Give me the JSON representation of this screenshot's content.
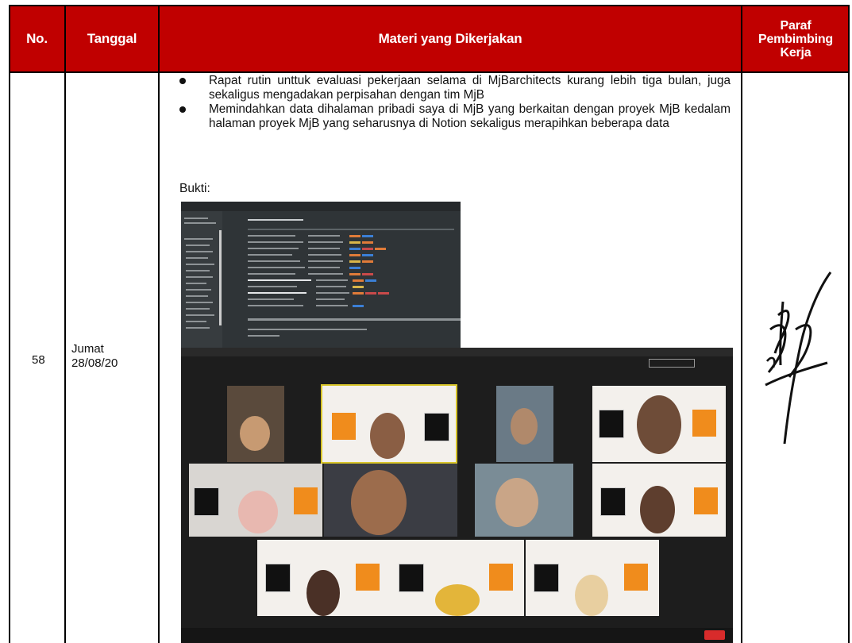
{
  "table": {
    "headers": {
      "no": "No.",
      "date": "Tanggal",
      "material": "Materi yang Dikerjakan",
      "paraf_line1": "Paraf",
      "paraf_line2": "Pembimbing",
      "paraf_line3": "Kerja"
    },
    "row": {
      "no": "58",
      "day": "Jumat",
      "date": "28/08/20",
      "tasks": [
        "Rapat rutin unttuk evaluasi pekerjaan selama di MjBarchitects kurang lebih tiga bulan, juga sekaligus mengadakan perpisahan dengan tim MjB",
        "Memindahkan data dihalaman pribadi saya di MjB yang berkaitan dengan proyek MjB kedalam halaman proyek MjB yang seharusnya di Notion sekaligus merapihkan beberapa data"
      ],
      "evidence_label": "Bukti:"
    }
  },
  "colors": {
    "header_bg": "#c00000",
    "header_text": "#ffffff",
    "zoom_bg": "#1d1d1d",
    "notion_bg": "#2f3437",
    "slide_orange": "#f08c1c"
  },
  "evidence": {
    "screenshot_1": "notion-workspace-dark-screenshot",
    "screenshot_2": "zoom-meeting-gallery-screenshot"
  },
  "signature": "handwritten-signature"
}
